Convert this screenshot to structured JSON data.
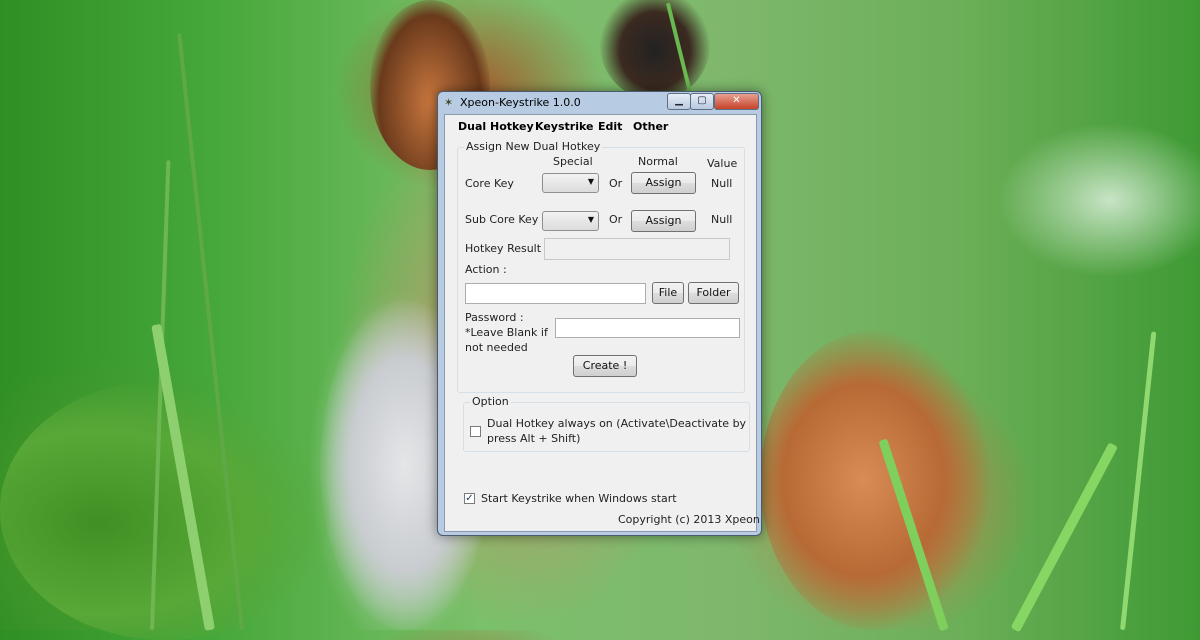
{
  "window": {
    "title": "Xpeon-Keystrike 1.0.0",
    "controls": {
      "minimize": "▁",
      "maximize": "▢",
      "close": "✕"
    }
  },
  "menu": [
    "Dual Hotkey",
    "Keystrike",
    "Edit",
    "Other"
  ],
  "assign_group": {
    "title": "Assign New Dual Hotkey",
    "col_special": "Special",
    "col_normal": "Normal",
    "col_value": "Value",
    "core_key": {
      "label": "Core Key",
      "or": "Or",
      "assign": "Assign",
      "value": "Null"
    },
    "sub_core_key": {
      "label": "Sub Core Key",
      "or": "Or",
      "assign": "Assign",
      "value": "Null"
    },
    "hotkey_result_label": "Hotkey Result :",
    "hotkey_result_value": "",
    "action_label": "Action :",
    "action_value": "",
    "file_button": "File",
    "folder_button": "Folder",
    "password_label_1": "Password :",
    "password_label_2": "*Leave Blank if",
    "password_label_3": "not needed",
    "password_value": "",
    "create_button": "Create !"
  },
  "option_group": {
    "title": "Option",
    "dual_hotkey_always_on": {
      "checked": false,
      "line1": "Dual Hotkey always on (Activate\\Deactivate by",
      "line2": "press Alt + Shift)"
    }
  },
  "start_with_windows": {
    "checked": true,
    "label": "Start Keystrike when Windows start"
  },
  "copyright": "Copyright (c) 2013 Xpeon",
  "colors": {
    "titlebar": "#b7cbe2",
    "close": "#c5422a",
    "client": "#f0f0f0"
  }
}
